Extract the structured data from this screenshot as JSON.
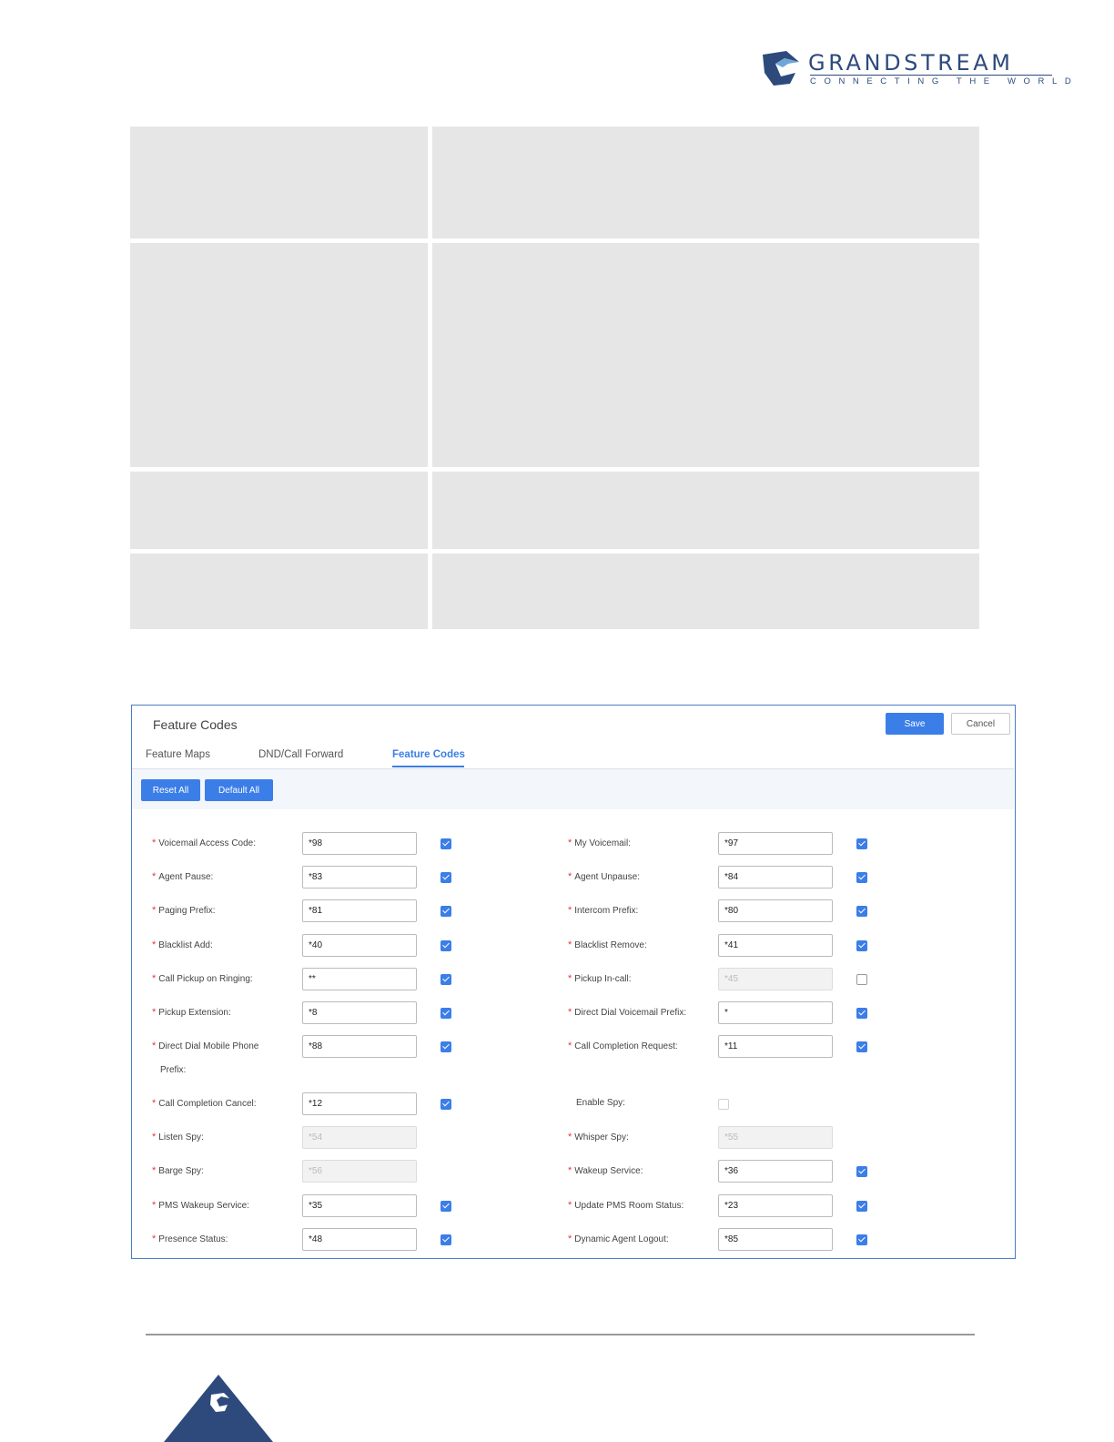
{
  "header": {
    "brand_name": "GRANDSTREAM",
    "brand_tagline": "CONNECTING THE WORLD",
    "brand_color": "#2e4a7d"
  },
  "panel": {
    "title": "Feature Codes",
    "save_label": "Save",
    "cancel_label": "Cancel",
    "tabs": [
      {
        "label": "Feature Maps",
        "active": false
      },
      {
        "label": "DND/Call Forward",
        "active": false
      },
      {
        "label": "Feature Codes",
        "active": true
      }
    ],
    "reset_all_label": "Reset All",
    "default_all_label": "Default All",
    "accent_color": "#3b7ee8",
    "left_fields": [
      {
        "label": "Voicemail Access Code:",
        "value": "*98",
        "required": true,
        "checked": true
      },
      {
        "label": "Agent Pause:",
        "value": "*83",
        "required": true,
        "checked": true
      },
      {
        "label": "Paging Prefix:",
        "value": "*81",
        "required": true,
        "checked": true
      },
      {
        "label": "Blacklist Add:",
        "value": "*40",
        "required": true,
        "checked": true
      },
      {
        "label": "Call Pickup on Ringing:",
        "value": "**",
        "required": true,
        "checked": true
      },
      {
        "label": "Pickup Extension:",
        "value": "*8",
        "required": true,
        "checked": true
      },
      {
        "label": "Direct Dial Mobile Phone",
        "label2": "Prefix:",
        "value": "*88",
        "required": true,
        "checked": true
      },
      {
        "label": "Call Completion Cancel:",
        "value": "*12",
        "required": true,
        "checked": true
      },
      {
        "label": "Listen Spy:",
        "value": "*54",
        "required": true,
        "disabled": true
      },
      {
        "label": "Barge Spy:",
        "value": "*56",
        "required": true,
        "disabled": true
      },
      {
        "label": "PMS Wakeup Service:",
        "value": "*35",
        "required": true,
        "checked": true
      },
      {
        "label": "Presence Status:",
        "value": "*48",
        "required": true,
        "checked": true
      }
    ],
    "right_fields": [
      {
        "label": "My Voicemail:",
        "value": "*97",
        "required": true,
        "checked": true
      },
      {
        "label": "Agent Unpause:",
        "value": "*84",
        "required": true,
        "checked": true
      },
      {
        "label": "Intercom Prefix:",
        "value": "*80",
        "required": true,
        "checked": true
      },
      {
        "label": "Blacklist Remove:",
        "value": "*41",
        "required": true,
        "checked": true
      },
      {
        "label": "Pickup In-call:",
        "value": "*45",
        "required": true,
        "disabled": true,
        "checked": false
      },
      {
        "label": "Direct Dial Voicemail Prefix:",
        "value": "*",
        "required": true,
        "checked": true
      },
      {
        "label": "Call Completion Request:",
        "value": "*11",
        "required": true,
        "checked": true
      },
      {
        "label": "Enable Spy:",
        "required": false,
        "checkbox_only": true,
        "checked": false
      },
      {
        "label": "Whisper Spy:",
        "value": "*55",
        "required": true,
        "disabled": true
      },
      {
        "label": "Wakeup Service:",
        "value": "*36",
        "required": true,
        "checked": true
      },
      {
        "label": "Update PMS Room Status:",
        "value": "*23",
        "required": true,
        "checked": true
      },
      {
        "label": "Dynamic Agent Logout:",
        "value": "*85",
        "required": true,
        "checked": true
      }
    ]
  }
}
